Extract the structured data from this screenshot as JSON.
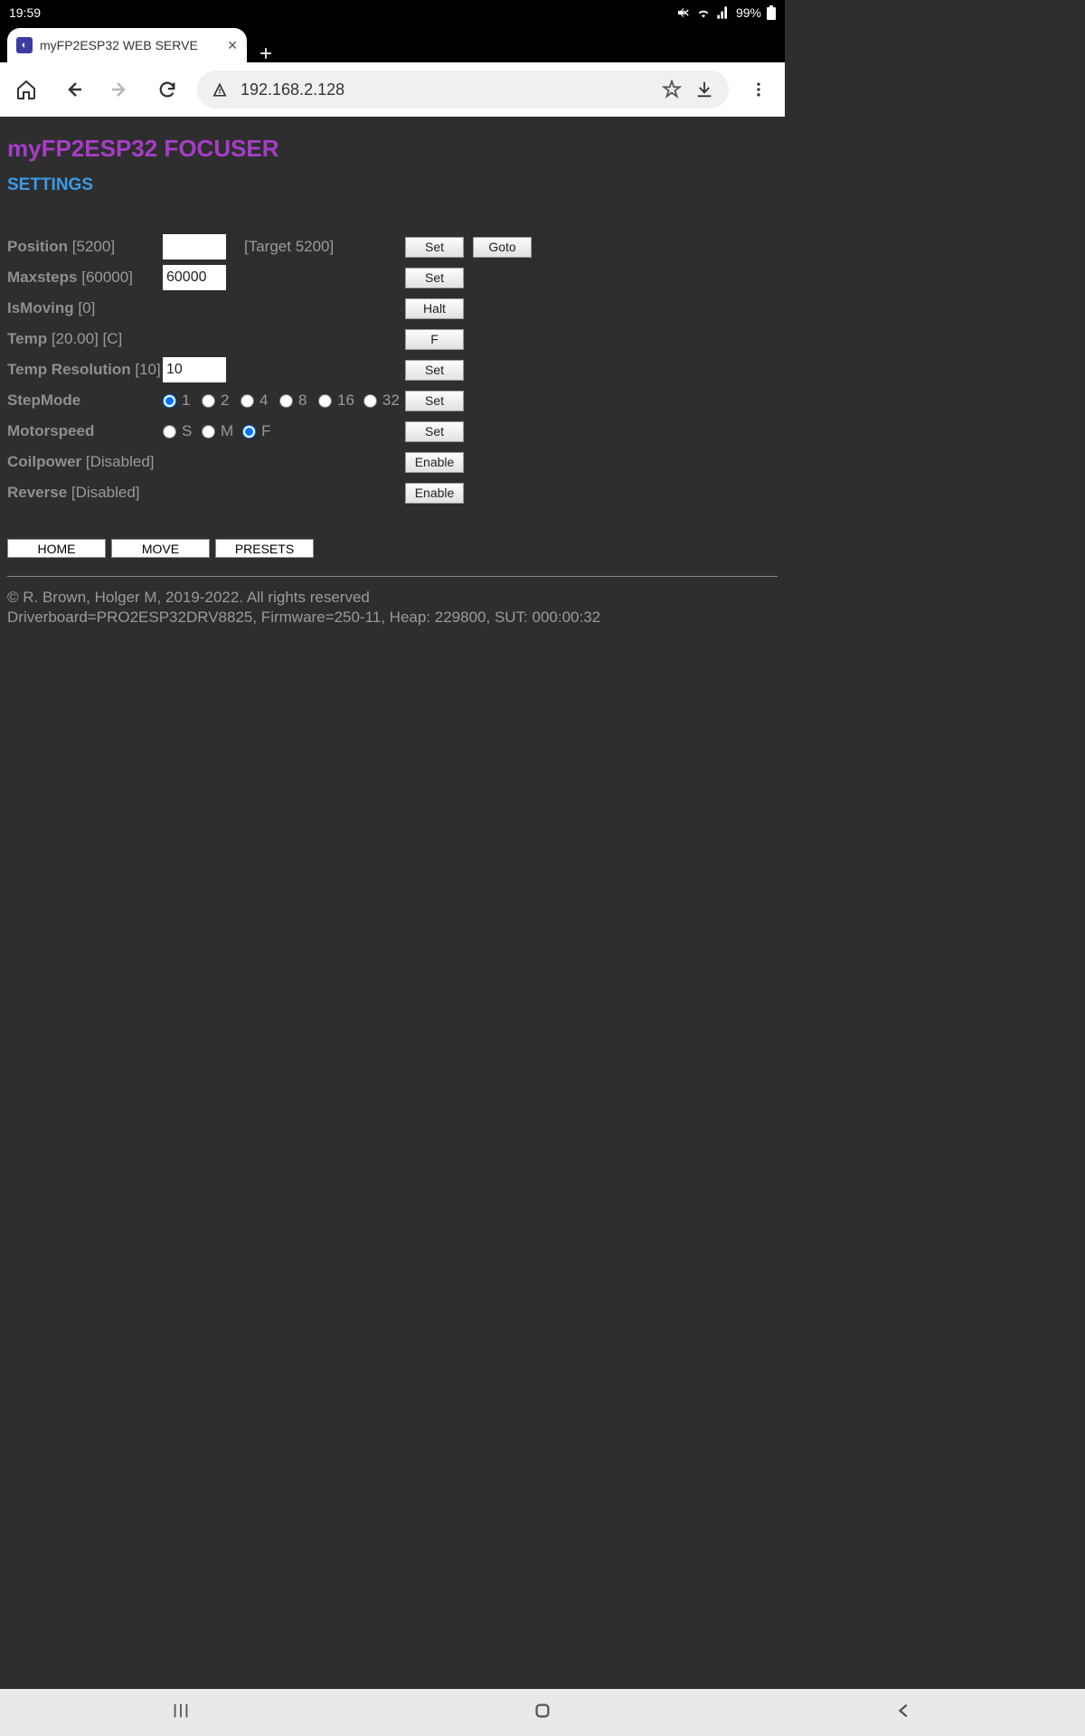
{
  "statusbar": {
    "time": "19:59",
    "battery": "99%"
  },
  "browser": {
    "tab_title": "myFP2ESP32 WEB SERVE",
    "url": "192.168.2.128"
  },
  "page": {
    "title": "myFP2ESP32 FOCUSER",
    "subtitle": "SETTINGS",
    "position": {
      "label": "Position",
      "current": "[5200]",
      "target_label": "[Target 5200]",
      "input": ""
    },
    "maxsteps": {
      "label": "Maxsteps",
      "current": "[60000]",
      "input": "60000"
    },
    "ismoving": {
      "label": "IsMoving",
      "value": "[0]"
    },
    "temp": {
      "label": "Temp",
      "value": "[20.00] [C]"
    },
    "tempres": {
      "label": "Temp Resolution",
      "current": "[10]",
      "input": "10"
    },
    "stepmode": {
      "label": "StepMode",
      "options": [
        "1",
        "2",
        "4",
        "8",
        "16",
        "32"
      ],
      "selected": "1"
    },
    "motorspeed": {
      "label": "Motorspeed",
      "options": [
        "S",
        "M",
        "F"
      ],
      "selected": "F"
    },
    "coilpower": {
      "label": "Coilpower",
      "value": "[Disabled]"
    },
    "reverse": {
      "label": "Reverse",
      "value": "[Disabled]"
    },
    "buttons": {
      "set": "Set",
      "goto": "Goto",
      "halt": "Halt",
      "f": "F",
      "enable": "Enable",
      "home": "HOME",
      "move": "MOVE",
      "presets": "PRESETS"
    },
    "footer": {
      "line1": "© R. Brown, Holger M, 2019-2022. All rights reserved",
      "line2": "Driverboard=PRO2ESP32DRV8825, Firmware=250-11, Heap: 229800, SUT: 000:00:32"
    }
  }
}
